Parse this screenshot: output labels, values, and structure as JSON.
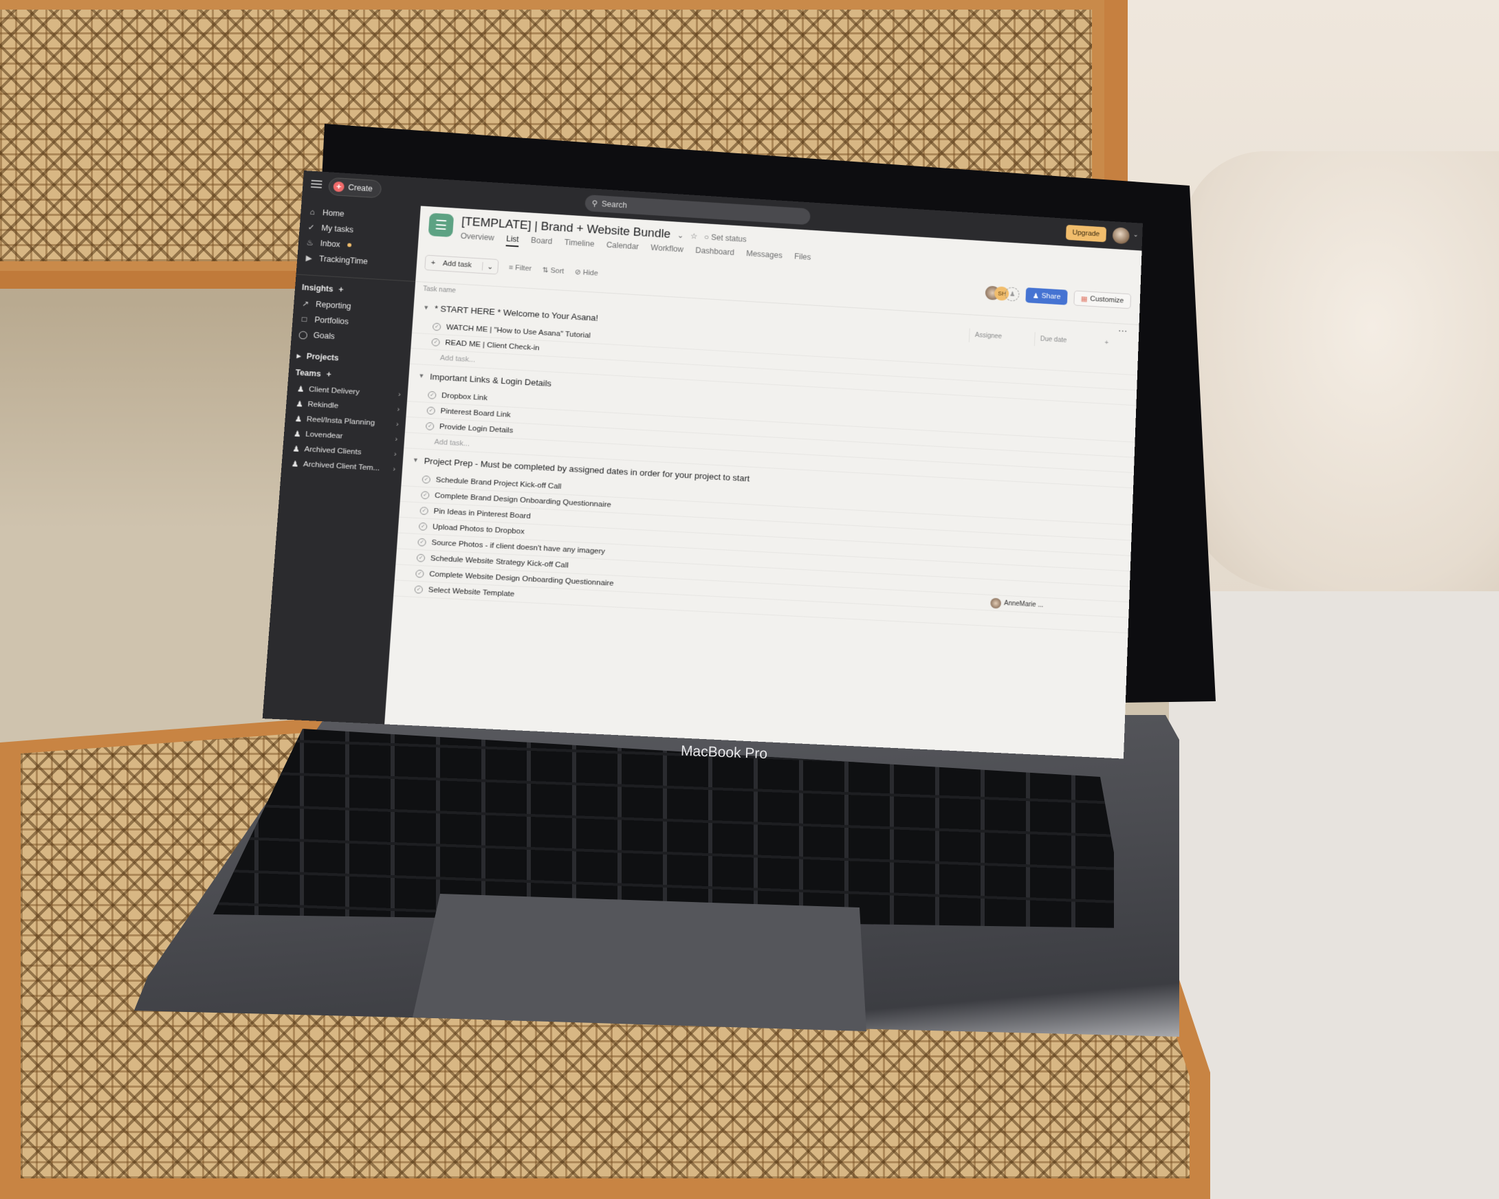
{
  "device": {
    "brand_label": "MacBook Pro"
  },
  "topbar": {
    "create_label": "Create",
    "search_placeholder": "Search",
    "upgrade_label": "Upgrade"
  },
  "sidebar": {
    "nav": [
      {
        "label": "Home",
        "icon": "home-icon"
      },
      {
        "label": "My tasks",
        "icon": "check-circle-icon"
      },
      {
        "label": "Inbox",
        "icon": "bell-icon",
        "badge": true
      },
      {
        "label": "TrackingTime",
        "icon": "trackingtime-icon"
      }
    ],
    "insights_label": "Insights",
    "insights": [
      {
        "label": "Reporting",
        "icon": "chart-line-icon"
      },
      {
        "label": "Portfolios",
        "icon": "folder-icon"
      },
      {
        "label": "Goals",
        "icon": "person-icon"
      }
    ],
    "projects_label": "Projects",
    "teams_label": "Teams",
    "teams": [
      "Client Delivery",
      "Rekindle",
      "Reel/Insta Planning",
      "Lovendear",
      "Archived Clients",
      "Archived Client Tem..."
    ]
  },
  "project": {
    "title": "[TEMPLATE] | Brand + Website Bundle",
    "set_status": "Set status",
    "tabs": [
      "Overview",
      "List",
      "Board",
      "Timeline",
      "Calendar",
      "Workflow",
      "Dashboard",
      "Messages",
      "Files"
    ],
    "active_tab": "List",
    "avatar_initials": "SH",
    "share_label": "Share",
    "customize_label": "Customize",
    "colors": {
      "icon_green": "#5da283",
      "share_blue": "#4573d2",
      "upgrade_yellow": "#f1bd6c",
      "create_red": "#f06a6a"
    }
  },
  "toolbar": {
    "add_task": "Add task",
    "filter": "Filter",
    "sort": "Sort",
    "hide": "Hide"
  },
  "list": {
    "col_task_name": "Task name",
    "col_assignee": "Assignee",
    "col_due_date": "Due date",
    "add_task_placeholder": "Add task...",
    "sections": [
      {
        "title": "* START HERE * Welcome to Your Asana!",
        "tasks": [
          "WATCH ME | \"How to Use Asana\" Tutorial",
          "READ ME | Client Check-in"
        ]
      },
      {
        "title": "Important Links & Login Details",
        "tasks": [
          "Dropbox Link",
          "Pinterest Board Link",
          "Provide Login Details"
        ]
      },
      {
        "title": "Project Prep - Must be completed by assigned dates in order for your project to start",
        "tasks": [
          "Schedule Brand Project Kick-off Call",
          "Complete Brand Design Onboarding Questionnaire",
          "Pin Ideas in Pinterest Board",
          "Upload Photos to Dropbox",
          "Source Photos - if client doesn't have any imagery",
          "Schedule Website Strategy Kick-off Call",
          "Complete Website Design Onboarding Questionnaire",
          "Select Website Template"
        ]
      }
    ],
    "assignee_on_row": "AnneMarie ..."
  }
}
